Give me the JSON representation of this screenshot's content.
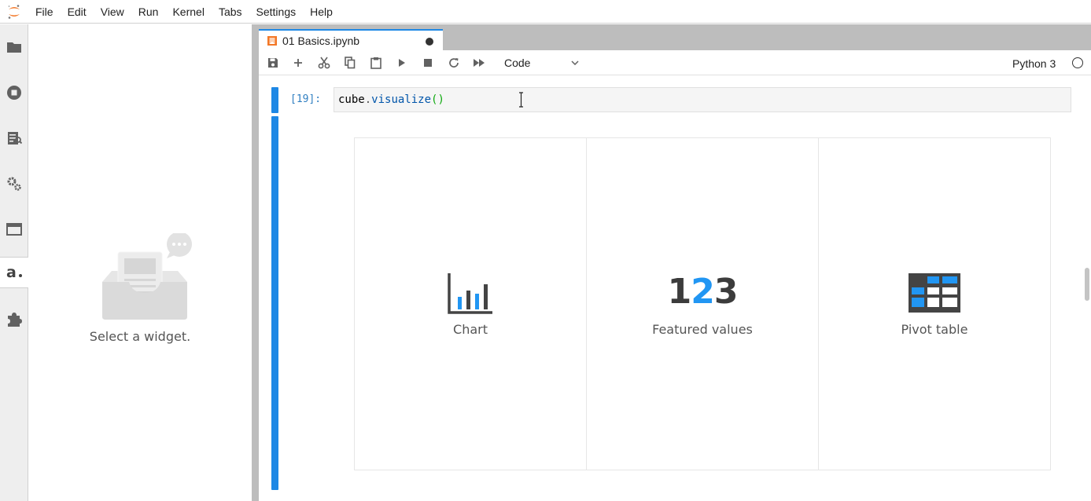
{
  "menubar": {
    "items": [
      "File",
      "Edit",
      "View",
      "Run",
      "Kernel",
      "Tabs",
      "Settings",
      "Help"
    ]
  },
  "activity_icons": [
    "folder-icon",
    "running-icon",
    "commands-icon",
    "property-inspector-icon",
    "tabs-icon",
    "atoti-icon",
    "extension-icon"
  ],
  "sidepanel": {
    "empty_text": "Select a widget."
  },
  "tab": {
    "title": "01 Basics.ipynb"
  },
  "toolbar": {
    "cell_type": "Code",
    "kernel_name": "Python 3"
  },
  "cell": {
    "prompt": "[19]:",
    "code": {
      "var": "cube",
      "dot": ".",
      "method": "visualize",
      "parens": "()"
    }
  },
  "widgets": [
    {
      "label": "Chart"
    },
    {
      "label": "Featured values",
      "num_a": "1",
      "num_b": "2",
      "num_c": "3"
    },
    {
      "label": "Pivot table"
    }
  ],
  "colors": {
    "accent": "#1e88e5",
    "icon": "#555555",
    "widget_blue": "#2196f3"
  }
}
